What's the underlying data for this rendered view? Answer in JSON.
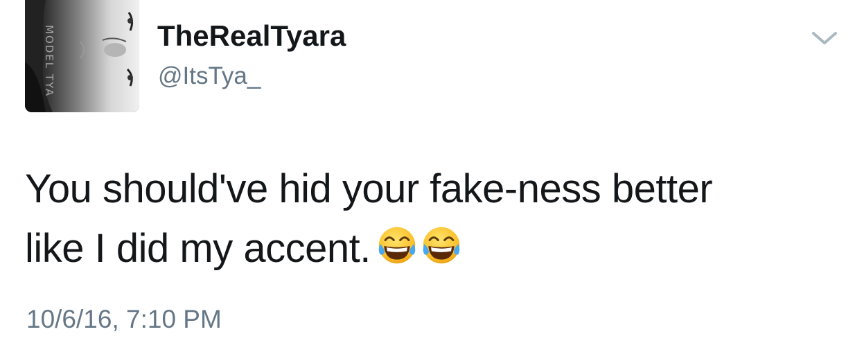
{
  "author": {
    "display_name": "TheRealTyara",
    "handle": "@ItsTya_",
    "avatar_watermark": "MODEL TYA"
  },
  "tweet": {
    "text_line_1": "You should've hid your fake-ness better",
    "text_line_2": "like I did my accent.",
    "emoji": [
      "face-with-tears-of-joy",
      "face-with-tears-of-joy"
    ],
    "timestamp": "10/6/16, 7:10 PM"
  },
  "icons": {
    "menu_caret": "chevron-down-icon"
  },
  "colors": {
    "primary_text": "#14171a",
    "secondary_text": "#657786",
    "caret": "#aab8c2",
    "background": "#ffffff"
  }
}
